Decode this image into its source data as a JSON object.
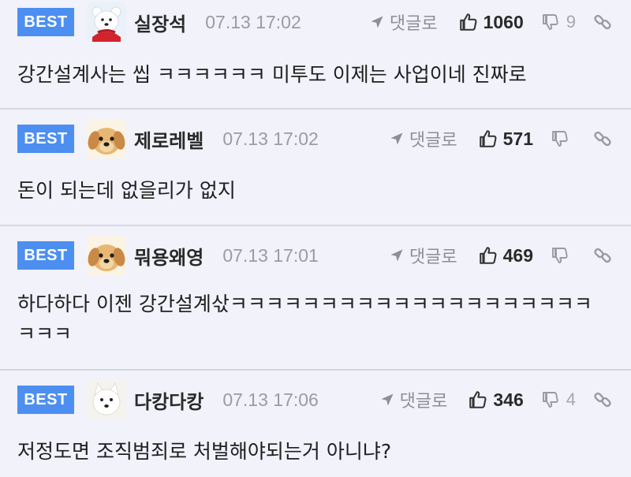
{
  "badge_label": "BEST",
  "reply_label": "댓글로",
  "colors": {
    "badge_bg": "#4d8ff0",
    "page_bg": "#f1f2fa",
    "divider": "#d5d7e0"
  },
  "comments": [
    {
      "username": "실장석",
      "avatar": "white-bear-avatar",
      "timestamp": "07.13 17:02",
      "likes": "1060",
      "dislikes": "9",
      "text": "강간설계사는 씹 ㅋㅋㅋㅋㅋㅋ 미투도 이제는 사업이네 진짜로"
    },
    {
      "username": "제로레벨",
      "avatar": "puppy-avatar",
      "timestamp": "07.13 17:02",
      "likes": "571",
      "dislikes": "",
      "text": "돈이 되는데 없을리가 없지"
    },
    {
      "username": "뭐용왜영",
      "avatar": "puppy-avatar",
      "timestamp": "07.13 17:01",
      "likes": "469",
      "dislikes": "",
      "text": "하다하다 이젠 강간설계삯ㅋㅋㅋㅋㅋㅋㅋㅋㅋㅋㅋㅋㅋㅋㅋㅋㅋㅋㅋㅋㅋㅋㅋ"
    },
    {
      "username": "다캉다캉",
      "avatar": "white-dog-avatar",
      "timestamp": "07.13 17:06",
      "likes": "346",
      "dislikes": "4",
      "text": "저정도면 조직범죄로 처벌해야되는거 아니냐?"
    }
  ]
}
